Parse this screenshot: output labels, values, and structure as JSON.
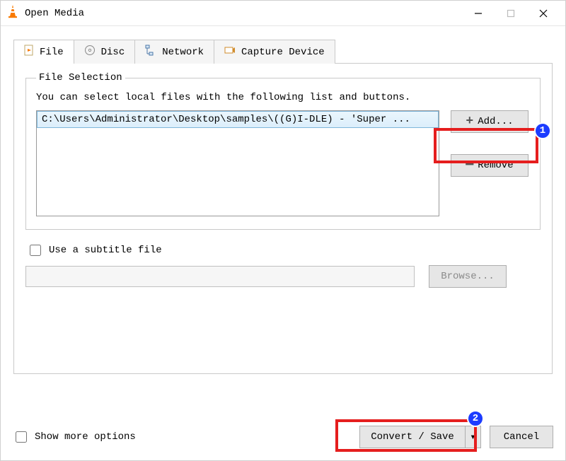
{
  "window": {
    "title": "Open Media"
  },
  "tabs": {
    "file": "File",
    "disc": "Disc",
    "network": "Network",
    "capture": "Capture Device"
  },
  "fileSelection": {
    "legend": "File Selection",
    "help": "You can select local files with the following list and buttons.",
    "items": [
      "C:\\Users\\Administrator\\Desktop\\samples\\((G)I-DLE) - 'Super ..."
    ],
    "addLabel": "Add...",
    "removeLabel": "Remove"
  },
  "subtitle": {
    "checkboxLabel": "Use a subtitle file",
    "path": "",
    "browseLabel": "Browse..."
  },
  "footer": {
    "showMoreLabel": "Show more options",
    "convertLabel": "Convert / Save",
    "cancelLabel": "Cancel"
  },
  "annotations": {
    "one": "1",
    "two": "2"
  }
}
